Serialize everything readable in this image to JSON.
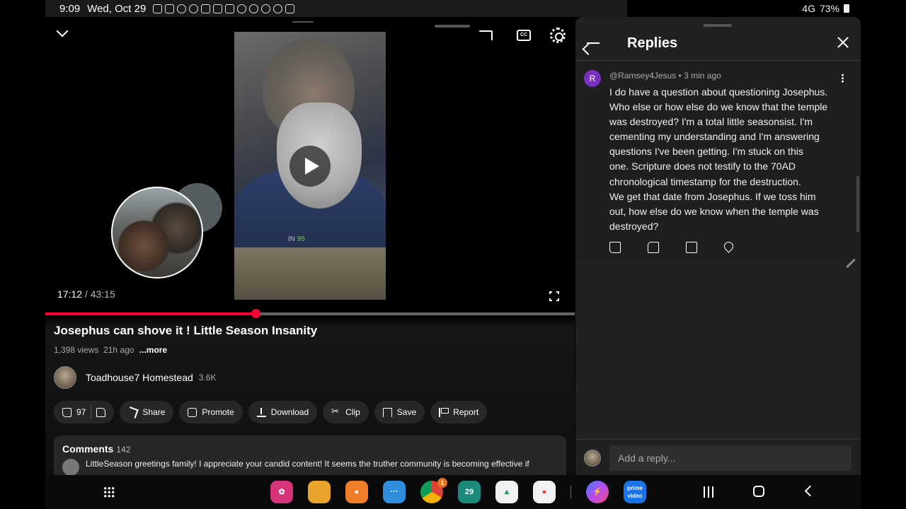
{
  "status_bar": {
    "time": "9:09",
    "date": "Wed, Oct 29",
    "signal": "4G",
    "battery": "73%"
  },
  "video": {
    "current_time": "17:12",
    "separator": " / ",
    "duration": "43:15",
    "progress_fraction": 0.397,
    "watermark": "IN",
    "watermark_accent": "95",
    "cc_label": "CC",
    "title": "Josephus can shove it ! Little Season Insanity",
    "views": "1,398 views",
    "age": "21h ago",
    "more_label": "...more"
  },
  "channel": {
    "name": "Toadhouse7 Homestead",
    "subscribers": "3.6K"
  },
  "actions": {
    "likes": "97",
    "share": "Share",
    "promote": "Promote",
    "download": "Download",
    "clip": "Clip",
    "save": "Save",
    "report": "Report"
  },
  "comments": {
    "heading": "Comments",
    "count": "142",
    "snippet": "LittleSeason greetings family!  I appreciate your candid content! It seems the truther community is becoming effective if"
  },
  "replies_panel": {
    "title": "Replies",
    "comment": {
      "avatar_letter": "R",
      "author": "@Ramsey4Jesus",
      "time": "3 min ago",
      "lines": [
        "I do have a question about questioning Josephus.",
        "Who else or how else do we know that the temple",
        "was destroyed?  I'm a total little seasonsist.  I'm",
        "cementing my understanding and I'm answering",
        "questions I've been getting.  I'm stuck on this",
        "one.  Scripture does not testify to the 70AD",
        "chronological timestamp for the destruction.",
        "We get that date from Josephus.  If we toss him",
        "out, how else do we know when the temple was",
        "destroyed?"
      ]
    },
    "reply_placeholder": "Add a reply..."
  },
  "dock": {
    "calendar_day": "29",
    "chrome_badge": "1",
    "prime_label": "prime video"
  },
  "colors": {
    "progress": "#ff0033",
    "avatar_r": "#7b2fbe",
    "panel_bg": "#212121",
    "chip_bg": "#272727"
  }
}
